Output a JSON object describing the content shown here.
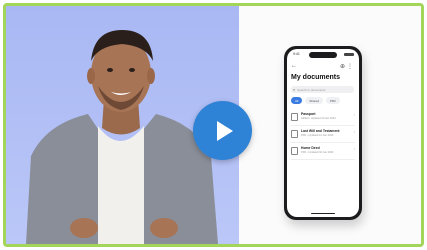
{
  "video": {
    "play_label": "Play video"
  },
  "phone": {
    "status_time": "9:41",
    "title": "My documents",
    "search_placeholder": "Search in documents",
    "chips": [
      "All",
      "Shared",
      "PDF"
    ],
    "documents": [
      {
        "name": "Passport",
        "sub": "Added • Updated 20 Jan 2023"
      },
      {
        "name": "Last Will and Testament",
        "sub": "PDF • Updated 14 Jan 2023"
      },
      {
        "name": "Home Deed",
        "sub": "PDF • Updated 02 Jan 2023"
      }
    ]
  },
  "colors": {
    "border": "#a3d55a",
    "play_button": "#2f83d6",
    "backdrop": "#b3c0f6"
  }
}
